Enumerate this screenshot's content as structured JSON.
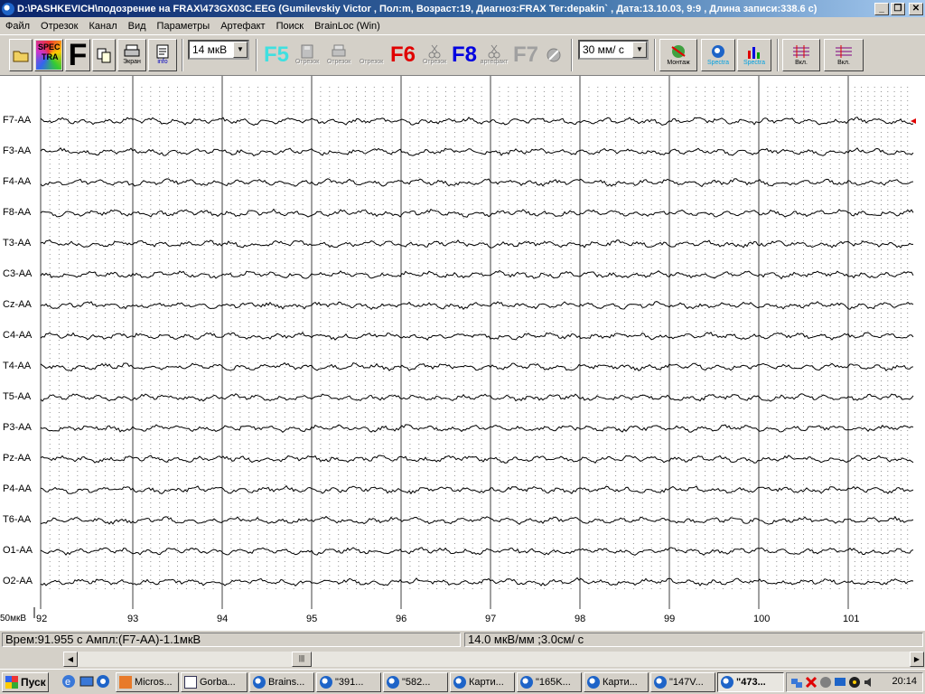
{
  "window": {
    "title": "D:\\PASHKEVICH\\подозрение на FRAX\\473GX03C.EEG (Gumilevskiy Victor , Пол:m, Возраст:19, Диагноз:FRAX Ter:depakin` , Дата:13.10.03, 9:9 , Длина записи:338.6 с)",
    "minimize": "_",
    "restore": "❐",
    "close": "✕"
  },
  "menu": [
    "Файл",
    "Отрезок",
    "Канал",
    "Вид",
    "Параметры",
    "Артефакт",
    "Поиск",
    "BrainLoc (Win)"
  ],
  "toolbar": {
    "spec_top": "SPEC",
    "spec_bottom": "TRA",
    "f_big": "F",
    "screen_label": "Экран",
    "info_label": "info",
    "amplitude": "14 мкВ",
    "f5": "F5",
    "f6": "F6",
    "f7": "F7",
    "f8": "F8",
    "segment_label": "Отрезок",
    "artifact_label": "артефакт",
    "speed": "30 мм/ с",
    "montage_label": "Монтаж",
    "spectra_label": "Spectra",
    "on_label": "Вкл."
  },
  "channels": [
    "F7-AA",
    "F3-AA",
    "F4-AA",
    "F8-AA",
    "T3-AA",
    "C3-AA",
    "Cz-AA",
    "C4-AA",
    "T4-AA",
    "T5-AA",
    "P3-AA",
    "Pz-AA",
    "P4-AA",
    "T6-AA",
    "O1-AA",
    "O2-AA"
  ],
  "time_axis": {
    "start_label": "92",
    "labels": [
      "93",
      "94",
      "95",
      "96",
      "97",
      "98",
      "99",
      "100",
      "101"
    ],
    "calibration": "50мкВ"
  },
  "status": {
    "left": "Врем:91.955 с Ампл:(F7-AA)-1.1мкВ",
    "right": "14.0 мкВ/мм ;3.0см/ с"
  },
  "scroll": {
    "left_arrow": "◀",
    "right_arrow": "▶",
    "thumb": "|||"
  },
  "taskbar": {
    "start": "Пуск",
    "tasks": [
      {
        "label": "Micros...",
        "icon": "ppt"
      },
      {
        "label": "Gorba...",
        "icon": "doc"
      },
      {
        "label": "Brains...",
        "icon": "eeg"
      },
      {
        "label": "\"391...",
        "icon": "eeg"
      },
      {
        "label": "\"582...",
        "icon": "eeg"
      },
      {
        "label": "Карти...",
        "icon": "eeg"
      },
      {
        "label": "\"165K...",
        "icon": "eeg"
      },
      {
        "label": "Карти...",
        "icon": "eeg"
      },
      {
        "label": "\"147V...",
        "icon": "eeg"
      },
      {
        "label": "\"473...",
        "icon": "eeg",
        "active": true
      }
    ],
    "clock": "20:14"
  },
  "colors": {
    "f5": "#40e0e0",
    "f6": "#e00000",
    "f8": "#0000e0",
    "f7": "#a0a0a0",
    "grid_major": "#404040",
    "grid_minor": "#909090"
  }
}
